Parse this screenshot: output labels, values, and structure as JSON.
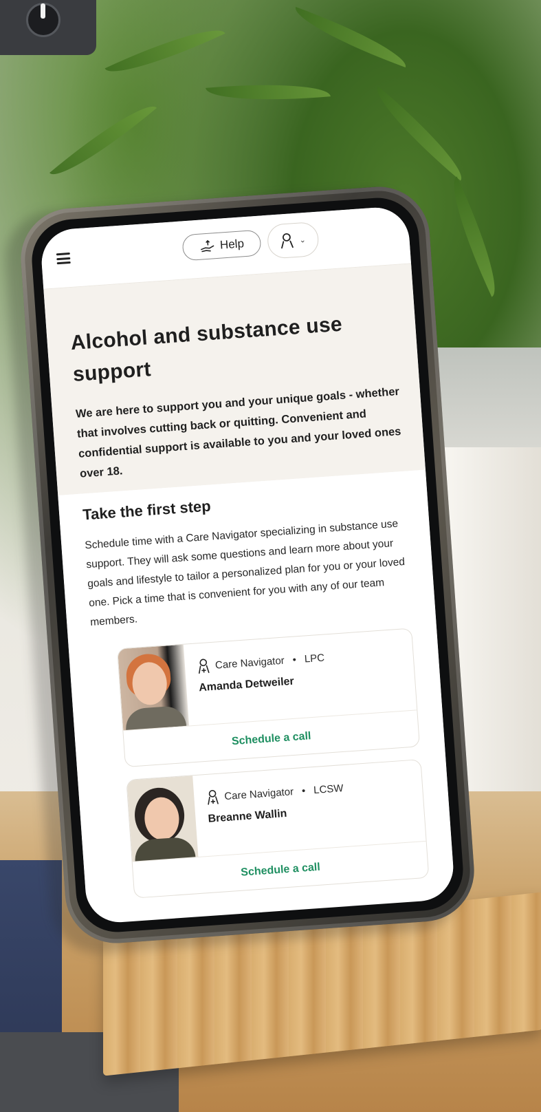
{
  "header": {
    "help_label": "Help"
  },
  "hero": {
    "title": "Alcohol and substance use support",
    "description": "We are here to support you and your unique goals - whether that involves cutting back or quitting. Convenient and confidential support is available to you and your loved ones over 18."
  },
  "first_step": {
    "heading": "Take the first step",
    "body": "Schedule time with a Care Navigator specializing in substance use support. They will ask some questions and learn more about your goals and lifestyle to tailor a personalized plan for you or your loved one. Pick a time that is convenient for you with any of our team members."
  },
  "navigators": [
    {
      "role": "Care Navigator",
      "credential": "LPC",
      "name": "Amanda Detweiler",
      "action": "Schedule a call"
    },
    {
      "role": "Care Navigator",
      "credential": "LCSW",
      "name": "Breanne Wallin",
      "action": "Schedule a call"
    }
  ],
  "colors": {
    "accent": "#1f8f61",
    "hero_bg": "#f5f2ed"
  },
  "icons": [
    "menu-icon",
    "helping-hand-icon",
    "person-icon",
    "chevron-down-icon",
    "care-navigator-icon"
  ]
}
